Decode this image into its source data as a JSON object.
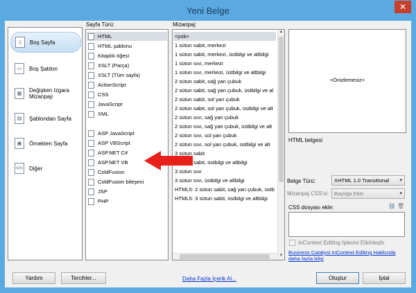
{
  "window": {
    "title": "Yeni Belge",
    "close_symbol": "✕"
  },
  "categories": {
    "items": [
      {
        "label": "Boş Sayfa",
        "icon": "blank-page-icon",
        "glyph": "▯"
      },
      {
        "label": "Boş Şablon",
        "icon": "blank-template-icon",
        "glyph": "▭"
      },
      {
        "label": "Değişken Izgara Mizanpajı",
        "label_line1": "Değişken Izgara",
        "label_line2": "Mizanpajı",
        "icon": "fluid-grid-icon",
        "glyph": "▦"
      },
      {
        "label": "Şablondan Sayfa",
        "icon": "page-from-template-icon",
        "glyph": "▤"
      },
      {
        "label": "Örnekten Sayfa",
        "icon": "page-from-sample-icon",
        "glyph": "▣"
      },
      {
        "label": "Diğer",
        "icon": "other-icon",
        "glyph": "</>"
      }
    ]
  },
  "page_type": {
    "label": "Sayfa Türü:",
    "items": [
      "HTML",
      "HTML şablonu",
      "Kitaplık öğesi",
      "XSLT (Parça)",
      "XSLT (Tüm sayfa)",
      "ActionScript",
      "CSS",
      "JavaScript",
      "XML",
      "ASP JavaScript",
      "ASP VBScript",
      "ASP.NET C#",
      "ASP.NET VB",
      "ColdFusion",
      "ColdFusion bileşeni",
      "JSP",
      "PHP"
    ]
  },
  "layout": {
    "label": "Mizanpaj:",
    "items": [
      "<yok>",
      "1 sütun sabit, merkezi",
      "1 sütun sabit, merkezi, üstbilgi ve altbilgi",
      "1 sütun sıvı, merkezi",
      "1 sütun sıvı, merkezi, üstbilgi ve altbilgi",
      "2 sütun sabit, sağ yan çubuk",
      "2 sütun sabit, sağ yan çubuk, üstbilgi ve al",
      "2 sütun sabit, sol yan çubuk",
      "2 sütun sabit, sol yan çubuk, üstbilgi ve alt",
      "2 sütun sıvı, sağ yan çubuk",
      "2 sütun sıvı, sağ yan çubuk, üstbilgi ve alt",
      "2 sütun sıvı, sol yan çubuk",
      "2 sütun sıvı, sol yan çubuk, üstbilgi ve alt",
      "3 sütun sabit",
      "3 sütun sabit, üstbilgi ve altbilgi",
      "3 sütun sıvı",
      "3 sütun sıvı, üstbilgi ve altbilgi",
      "HTML5: 2 sütun sabit, sağ yan çubuk, üstb",
      "HTML5: 3 sütun sabit, üstbilgi ve altbilgi"
    ]
  },
  "preview": {
    "placeholder": "<Önizlemesiz>",
    "description": "HTML belgesi"
  },
  "doc_type": {
    "label": "Belge Türü:",
    "value": "XHTML 1.0 Transitional"
  },
  "layout_css": {
    "label": "Mizanpaj CSS'si:",
    "value": "Başlığa Ekle"
  },
  "attach_css": {
    "label": "CSS dosyası ekle:"
  },
  "incontext": {
    "checkbox_label": "InContext Editing İşlevini Etkinleştir",
    "link_line1": "Business Catalyst InContext Editing Hakkında",
    "link_line2": "daha fazla bilgi"
  },
  "footer": {
    "help": "Yardım",
    "preferences": "Tercihler...",
    "more_content": "Daha Fazla İçerik Al...",
    "create": "Oluştur",
    "cancel": "İptal"
  },
  "colors": {
    "accent_arrow": "#e8201a",
    "title_bar": "#5aa9e0"
  }
}
